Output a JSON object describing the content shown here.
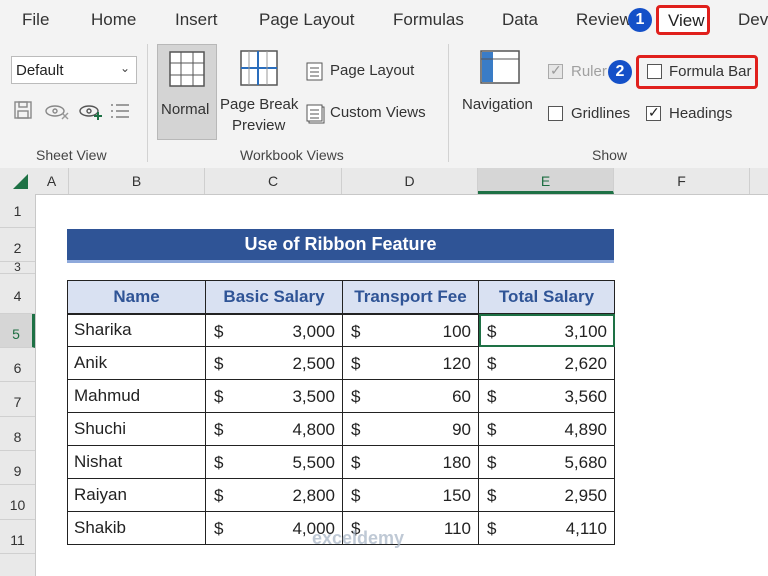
{
  "menu": {
    "tabs": [
      "File",
      "Home",
      "Insert",
      "Page Layout",
      "Formulas",
      "Data",
      "Review"
    ],
    "active_tab": "View",
    "clipped_tab": "Dev"
  },
  "badges": {
    "step1": "1",
    "step2": "2"
  },
  "ribbon": {
    "style_select": "Default",
    "sheet_view_label": "Sheet View",
    "workbook_views_label": "Workbook Views",
    "show_label": "Show",
    "normal": "Normal",
    "page_break_line1": "Page Break",
    "page_break_line2": "Preview",
    "page_layout": "Page Layout",
    "custom_views": "Custom Views",
    "navigation": "Navigation",
    "ruler": "Ruler",
    "formula_bar": "Formula Bar",
    "gridlines": "Gridlines",
    "headings": "Headings",
    "ruler_checked": true,
    "formula_bar_checked": false,
    "gridlines_checked": false,
    "headings_checked": true
  },
  "columns": [
    "A",
    "B",
    "C",
    "D",
    "E",
    "F"
  ],
  "active_column": "E",
  "rows": [
    "1",
    "2",
    "3",
    "4",
    "5",
    "6",
    "7",
    "8",
    "9",
    "10",
    "11"
  ],
  "active_row": "5",
  "sheet": {
    "title": "Use of Ribbon Feature",
    "headers": [
      "Name",
      "Basic Salary",
      "Transport Fee",
      "Total Salary"
    ],
    "currency": "$",
    "records": [
      {
        "name": "Sharika",
        "basic": "3,000",
        "transport": "100",
        "total": "3,100"
      },
      {
        "name": "Anik",
        "basic": "2,500",
        "transport": "120",
        "total": "2,620"
      },
      {
        "name": "Mahmud",
        "basic": "3,500",
        "transport": "60",
        "total": "3,560"
      },
      {
        "name": "Shuchi",
        "basic": "4,800",
        "transport": "90",
        "total": "4,890"
      },
      {
        "name": "Nishat",
        "basic": "5,500",
        "transport": "180",
        "total": "5,680"
      },
      {
        "name": "Raiyan",
        "basic": "2,800",
        "transport": "150",
        "total": "2,950"
      },
      {
        "name": "Shakib",
        "basic": "4,000",
        "transport": "110",
        "total": "4,110"
      }
    ]
  },
  "watermark": "exceldemy",
  "colors": {
    "title_bg": "#2f5496",
    "header_bg": "#d9e1f2",
    "highlight": "#e0201c",
    "badge": "#1450c8",
    "selection": "#1e7145"
  }
}
